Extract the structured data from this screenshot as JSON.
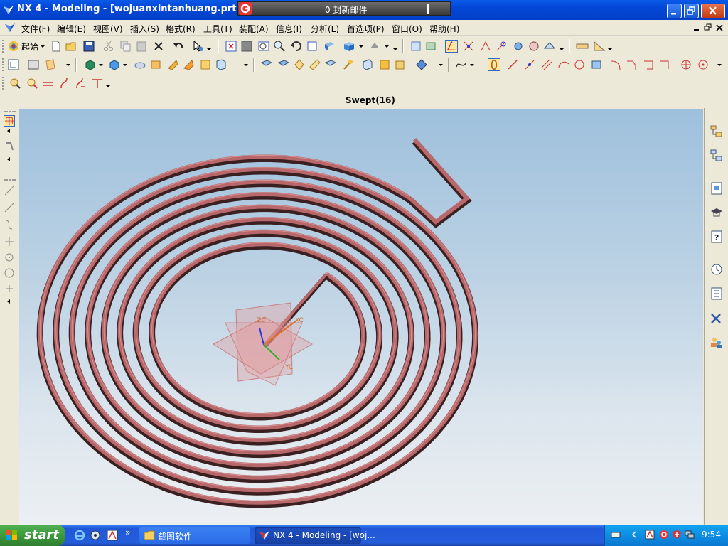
{
  "window": {
    "title": "NX 4 - Modeling - [wojuanxintanhuang.prt]"
  },
  "mail_notice": {
    "text": "0 封新邮件"
  },
  "menu": {
    "items": [
      {
        "label": "文件(F)"
      },
      {
        "label": "编辑(E)"
      },
      {
        "label": "视图(V)"
      },
      {
        "label": "插入(S)"
      },
      {
        "label": "格式(R)"
      },
      {
        "label": "工具(T)"
      },
      {
        "label": "装配(A)"
      },
      {
        "label": "信息(I)"
      },
      {
        "label": "分析(L)"
      },
      {
        "label": "首选项(P)"
      },
      {
        "label": "窗口(O)"
      },
      {
        "label": "帮助(H)"
      }
    ]
  },
  "toolbar": {
    "start_label": "起始"
  },
  "status": {
    "selection": "Swept(16)"
  },
  "viewport": {
    "axis_labels": {
      "zc": "ZC",
      "xc": "XC",
      "yc": "YC"
    },
    "model_color": "#b8686a",
    "model_edge": "#3a2020"
  },
  "taskbar": {
    "start_label": "start",
    "tasks": [
      {
        "label": "截图软件"
      },
      {
        "label": "NX 4 - Modeling - [woj..."
      }
    ],
    "clock": "9:54"
  }
}
